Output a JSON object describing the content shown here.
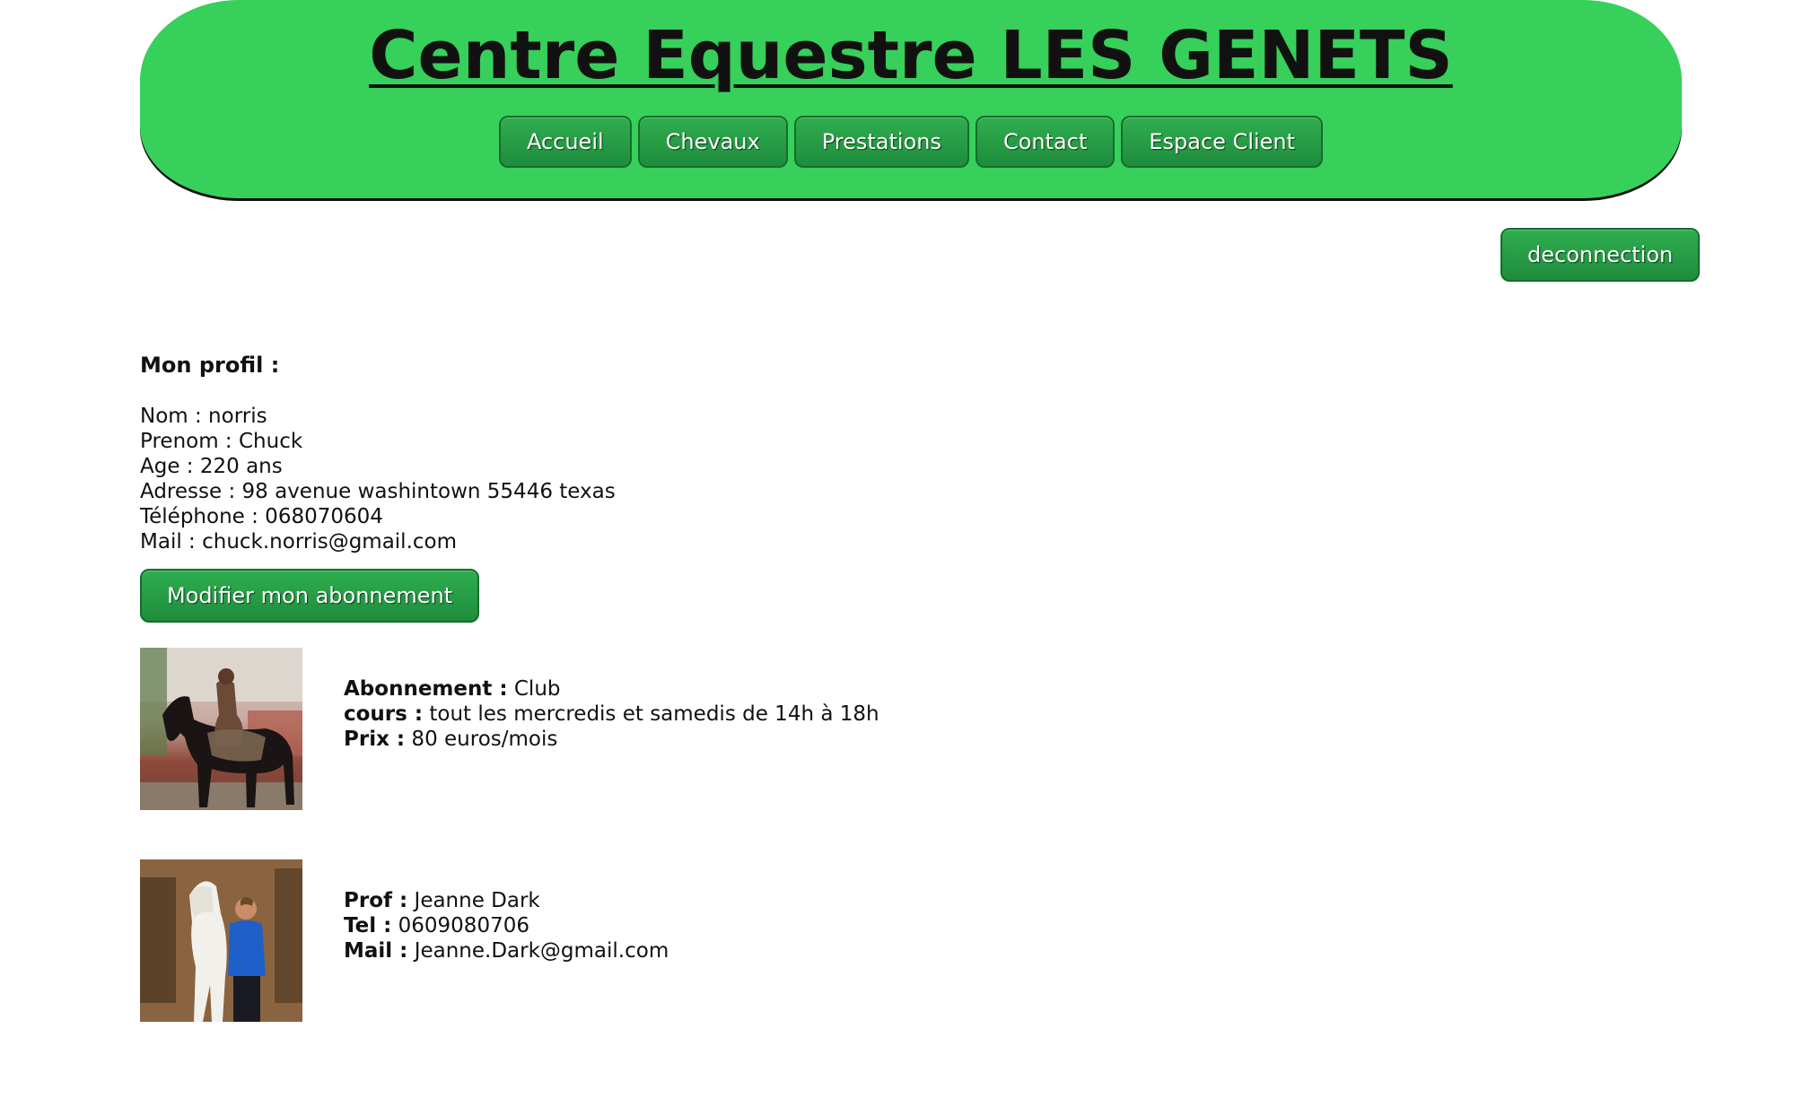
{
  "header": {
    "title": "Centre Equestre LES GENETS",
    "nav": [
      "Accueil",
      "Chevaux",
      "Prestations",
      "Contact",
      "Espace Client"
    ]
  },
  "logout_label": "deconnection",
  "profile": {
    "heading": "Mon profil :",
    "lines": [
      "Nom : norris",
      "Prenom : Chuck",
      "Age : 220 ans",
      "Adresse : 98 avenue washintown 55446 texas",
      "Téléphone : 068070604",
      "Mail : chuck.norris@gmail.com"
    ],
    "modify_label": "Modifier mon abonnement"
  },
  "subscription": {
    "abonnement_label": "Abonnement :",
    "abonnement_value": " Club",
    "cours_label": "cours :",
    "cours_value": " tout les mercredis et samedis de 14h à 18h",
    "prix_label": "Prix :",
    "prix_value": " 80 euros/mois"
  },
  "teacher": {
    "prof_label": "Prof :",
    "prof_value": " Jeanne Dark",
    "tel_label": "Tel :",
    "tel_value": " 0609080706",
    "mail_label": "Mail :",
    "mail_value": " Jeanne.Dark@gmail.com"
  },
  "colors": {
    "header_bg": "#36d05a",
    "button_bg": "#1f8c3c"
  }
}
